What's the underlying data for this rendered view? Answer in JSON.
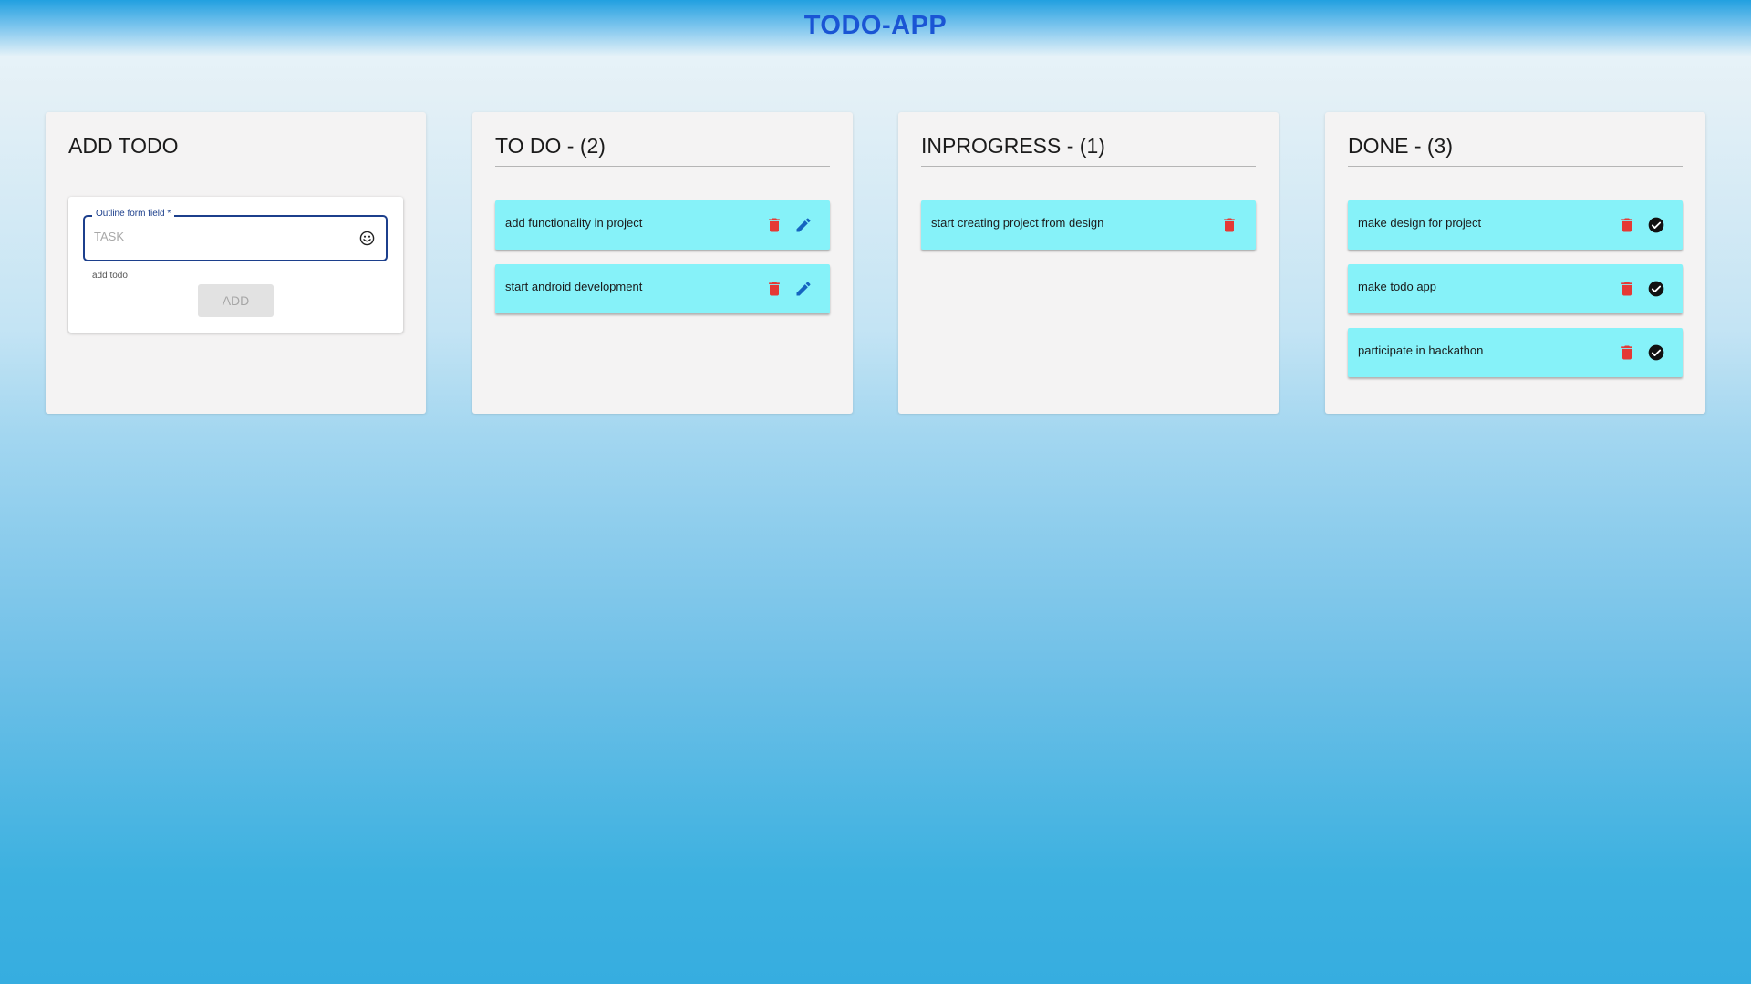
{
  "app": {
    "title": "TODO-APP"
  },
  "add_panel": {
    "title": "ADD TODO",
    "field_label": "Outline form field *",
    "placeholder": "TASK",
    "value": "",
    "hint": "add todo",
    "add_label": "ADD"
  },
  "todo_panel": {
    "title": "TO DO - (2)",
    "tasks": [
      {
        "label": "add functionality in project"
      },
      {
        "label": "start android development"
      }
    ]
  },
  "inprogress_panel": {
    "title": "INPROGRESS - (1)",
    "tasks": [
      {
        "label": "start creating project from design"
      }
    ]
  },
  "done_panel": {
    "title": "DONE - (3)",
    "tasks": [
      {
        "label": "make design for project"
      },
      {
        "label": "make todo app"
      },
      {
        "label": "participate in hackathon"
      }
    ]
  },
  "icons": {
    "delete": "trash-icon",
    "edit": "pencil-icon",
    "done": "check-circle-icon",
    "emoji": "smiley-icon"
  },
  "colors": {
    "title": "#1a55d4",
    "card": "#86f2f9",
    "delete": "#e53935",
    "edit": "#1565c0",
    "panel": "#f4f3f3"
  }
}
